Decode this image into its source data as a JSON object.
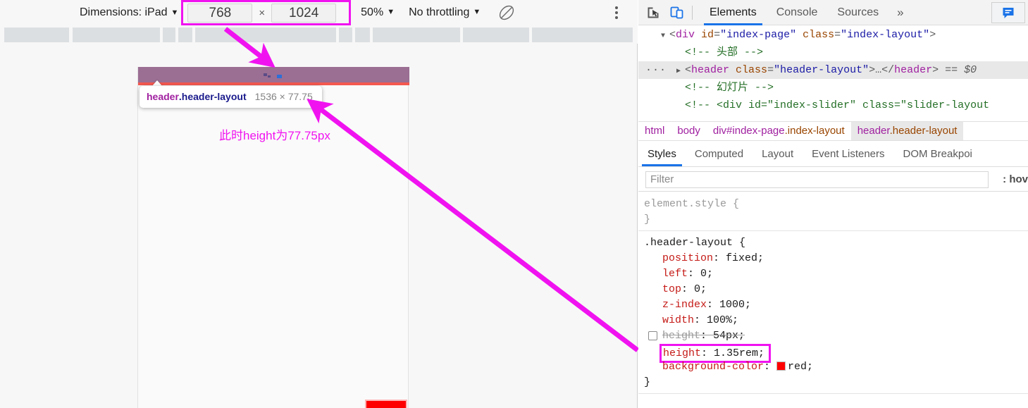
{
  "device_toolbar": {
    "dimensions_label": "Dimensions: iPad",
    "dimensions_caret": "▼",
    "width_value": "768",
    "times": "×",
    "height_value": "1024",
    "zoom_value": "50%",
    "zoom_caret": "▼",
    "throttling_value": "No throttling",
    "throttling_caret": "▼",
    "rotate_icon": "rotate-device-icon",
    "menu_icon": "kebab-menu-icon",
    "highlight_color": "#f013f0"
  },
  "viewport": {
    "highlight_overlay_color": "#9b6e93",
    "red_strip_color": "#f4584f",
    "bottom_element_color": "#fe0000",
    "bottom_element_text": "",
    "tooltip": {
      "tag": "header",
      "class": ".header-layout",
      "dimensions": "1536 × 77.75"
    },
    "annotation": "此时height为77.75px",
    "annotation_color": "#f013f0"
  },
  "devtools": {
    "toolbar_icons": {
      "inspect": "inspect-element-icon",
      "device": "toggle-device-toolbar-icon",
      "feedback": "feedback-icon"
    },
    "tabs": [
      {
        "label": "Elements",
        "active": true
      },
      {
        "label": "Console",
        "active": false
      },
      {
        "label": "Sources",
        "active": false
      }
    ],
    "more_tabs": "»",
    "dom_tree": [
      {
        "type": "element",
        "twisty": "▼",
        "indent": 1,
        "selected": false,
        "parts": [
          {
            "t": "punct",
            "s": "<"
          },
          {
            "t": "tag",
            "s": "div"
          },
          {
            "t": "plain",
            "s": " "
          },
          {
            "t": "attr",
            "s": "id"
          },
          {
            "t": "punct",
            "s": "="
          },
          {
            "t": "val",
            "s": "\"index-page\""
          },
          {
            "t": "plain",
            "s": " "
          },
          {
            "t": "attr",
            "s": "class"
          },
          {
            "t": "punct",
            "s": "="
          },
          {
            "t": "val",
            "s": "\"index-layout\""
          },
          {
            "t": "punct",
            "s": ">"
          }
        ]
      },
      {
        "type": "comment",
        "twisty": "",
        "indent": 2,
        "selected": false,
        "parts": [
          {
            "t": "cmt",
            "s": "<!-- 头部 -->"
          }
        ]
      },
      {
        "type": "element",
        "twisty": "▶",
        "indent": 2,
        "selected": true,
        "dots": "···",
        "parts": [
          {
            "t": "punct",
            "s": "<"
          },
          {
            "t": "tag",
            "s": "header"
          },
          {
            "t": "plain",
            "s": " "
          },
          {
            "t": "attr",
            "s": "class"
          },
          {
            "t": "punct",
            "s": "="
          },
          {
            "t": "val",
            "s": "\"header-layout\""
          },
          {
            "t": "punct",
            "s": ">…</"
          },
          {
            "t": "tag",
            "s": "header"
          },
          {
            "t": "punct",
            "s": ">"
          },
          {
            "t": "plain",
            "s": " "
          },
          {
            "t": "dollar",
            "s": "== $0"
          }
        ]
      },
      {
        "type": "comment",
        "twisty": "",
        "indent": 2,
        "selected": false,
        "parts": [
          {
            "t": "cmt",
            "s": "<!-- 幻灯片 -->"
          }
        ]
      },
      {
        "type": "comment",
        "twisty": "",
        "indent": 2,
        "selected": false,
        "parts": [
          {
            "t": "cmt",
            "s": "<!-- <div id=\"index-slider\" class=\"slider-layout"
          }
        ]
      }
    ],
    "breadcrumbs": [
      {
        "tag": "html",
        "cls": "",
        "active": false
      },
      {
        "tag": "body",
        "cls": "",
        "active": false
      },
      {
        "tag": "div#index-page",
        "cls": ".index-layout",
        "active": false
      },
      {
        "tag": "header",
        "cls": ".header-layout",
        "active": true
      }
    ],
    "style_tabs": [
      {
        "label": "Styles",
        "active": true
      },
      {
        "label": "Computed",
        "active": false
      },
      {
        "label": "Layout",
        "active": false
      },
      {
        "label": "Event Listeners",
        "active": false
      },
      {
        "label": "DOM Breakpoi",
        "active": false
      }
    ],
    "filter_placeholder": "Filter",
    "hover_button": ": hov",
    "css_rules": [
      {
        "selector": "element.style",
        "selector_style": "gray",
        "declarations": []
      },
      {
        "selector": ".header-layout",
        "selector_style": "dark",
        "declarations": [
          {
            "prop": "position",
            "value": "fixed",
            "disabled": false,
            "highlighted": false,
            "swatch": ""
          },
          {
            "prop": "left",
            "value": "0",
            "disabled": false,
            "highlighted": false,
            "swatch": ""
          },
          {
            "prop": "top",
            "value": "0",
            "disabled": false,
            "highlighted": false,
            "swatch": ""
          },
          {
            "prop": "z-index",
            "value": "1000",
            "disabled": false,
            "highlighted": false,
            "swatch": ""
          },
          {
            "prop": "width",
            "value": "100%",
            "disabled": false,
            "highlighted": false,
            "swatch": ""
          },
          {
            "prop": "height",
            "value": "54px",
            "disabled": true,
            "highlighted": false,
            "swatch": ""
          },
          {
            "prop": "height",
            "value": "1.35rem",
            "disabled": false,
            "highlighted": true,
            "swatch": ""
          },
          {
            "prop": "background-color",
            "value": "red",
            "disabled": false,
            "highlighted": false,
            "swatch": "#ff0000"
          }
        ]
      }
    ]
  }
}
